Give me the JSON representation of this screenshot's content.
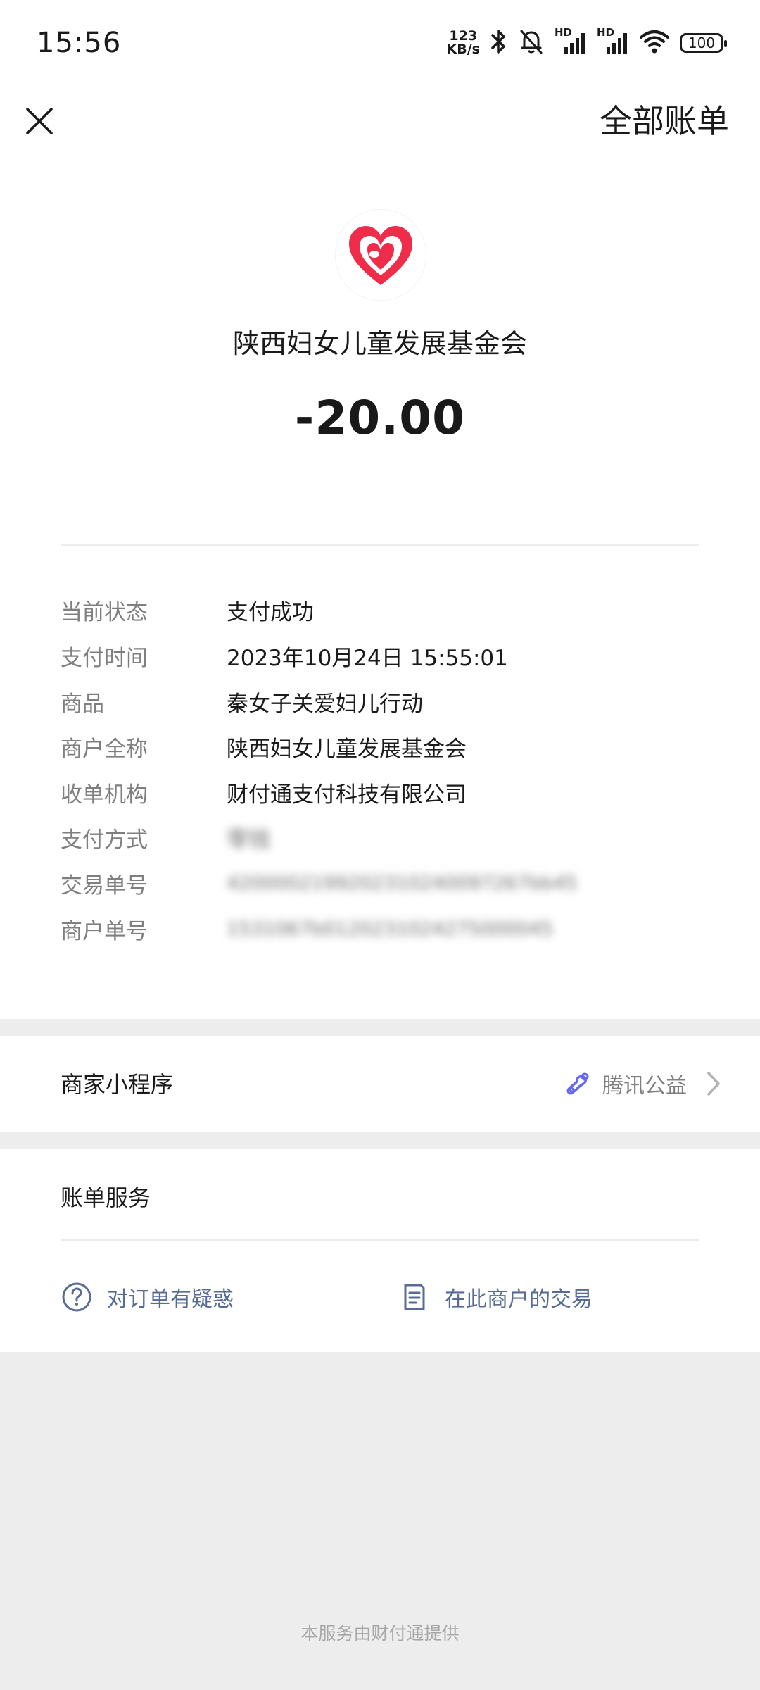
{
  "status_bar": {
    "time": "15:56",
    "net_speed_value": "123",
    "net_speed_unit": "KB/s",
    "signal1_label": "HD",
    "signal2_label": "HD",
    "battery": "100"
  },
  "nav": {
    "close_icon": "close-icon",
    "all_bills_label": "全部账单"
  },
  "merchant": {
    "name": "陕西妇女儿童发展基金会",
    "logo_color": "#ef2d4a"
  },
  "amount": "-20.00",
  "details": [
    {
      "label": "当前状态",
      "value": "支付成功"
    },
    {
      "label": "支付时间",
      "value": "2023年10月24日 15:55:01"
    },
    {
      "label": "商品",
      "value": "秦女子关爱妇儿行动"
    },
    {
      "label": "商户全称",
      "value": "陕西妇女儿童发展基金会"
    },
    {
      "label": "收单机构",
      "value": "财付通支付科技有限公司"
    },
    {
      "label": "支付方式",
      "value": "零钱"
    },
    {
      "label": "交易单号",
      "value": "4200002199202310240097267bb45"
    },
    {
      "label": "商户单号",
      "value": "1531067b0120231024275000045"
    }
  ],
  "mini_program": {
    "label": "商家小程序",
    "name": "腾讯公益",
    "icon_color": "#6467f0"
  },
  "bill_service": {
    "title": "账单服务",
    "question_label": "对订单有疑惑",
    "transactions_label": "在此商户的交易",
    "link_color": "#576b95"
  },
  "footer": "本服务由财付通提供"
}
